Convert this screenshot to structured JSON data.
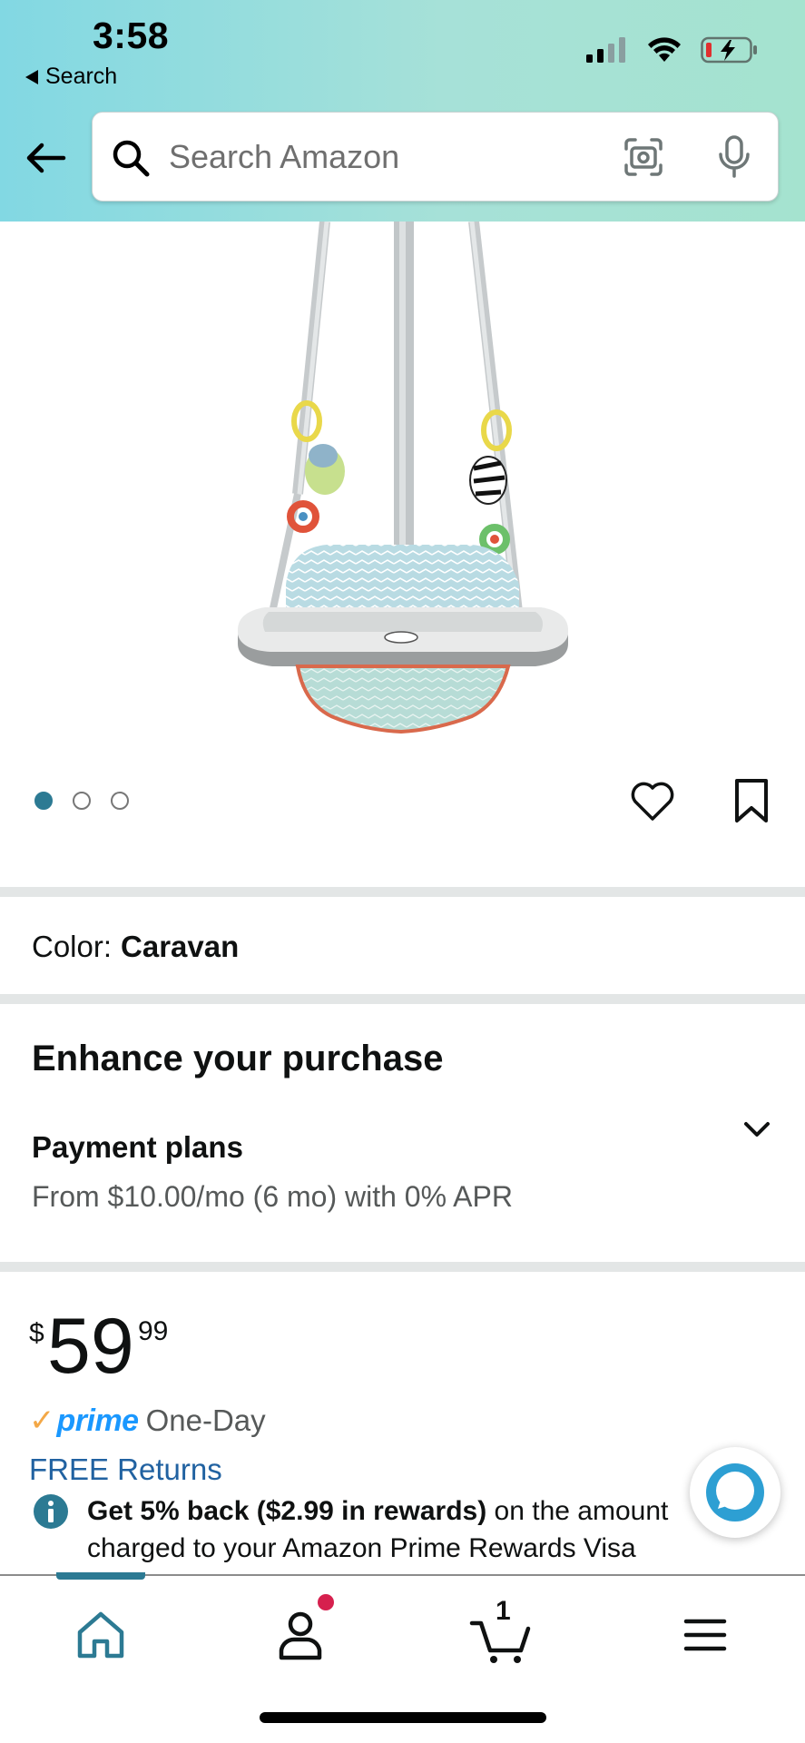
{
  "status_bar": {
    "time": "3:58",
    "back_label": "Search"
  },
  "header": {
    "search_placeholder": "Search Amazon"
  },
  "gallery": {
    "image_count": 3,
    "active_index": 0
  },
  "product": {
    "color_label": "Color:",
    "color_value": "Caravan"
  },
  "enhance": {
    "title": "Enhance your purchase",
    "payment_title": "Payment plans",
    "payment_subtitle": "From $10.00/mo (6 mo) with 0% APR"
  },
  "pricing": {
    "currency_symbol": "$",
    "price_whole": "59",
    "price_fraction": "99",
    "prime_check": "✓",
    "prime_label": "prime",
    "delivery_label": "One-Day",
    "returns_label": "FREE Returns",
    "promo_bold": "Get 5% back ($2.99 in rewards)",
    "promo_rest": " on the amount charged to your Amazon Prime Rewards Visa Signature Card"
  },
  "bottom_nav": {
    "cart_count": "1",
    "active_tab": "home"
  },
  "colors": {
    "header_gradient_start": "#82d8e3",
    "header_gradient_end": "#a5e3cf",
    "accent_teal": "#2c7a93",
    "link_blue": "#2162a1",
    "prime_blue": "#1a98ff",
    "prime_orange": "#f3a847",
    "notification_red": "#d6204e"
  },
  "icons": [
    "back-arrow-icon",
    "search-icon",
    "camera-icon",
    "mic-icon",
    "heart-icon",
    "bookmark-icon",
    "chevron-down-icon",
    "info-icon",
    "alexa-icon",
    "home-icon",
    "account-icon",
    "cart-icon",
    "menu-icon"
  ]
}
